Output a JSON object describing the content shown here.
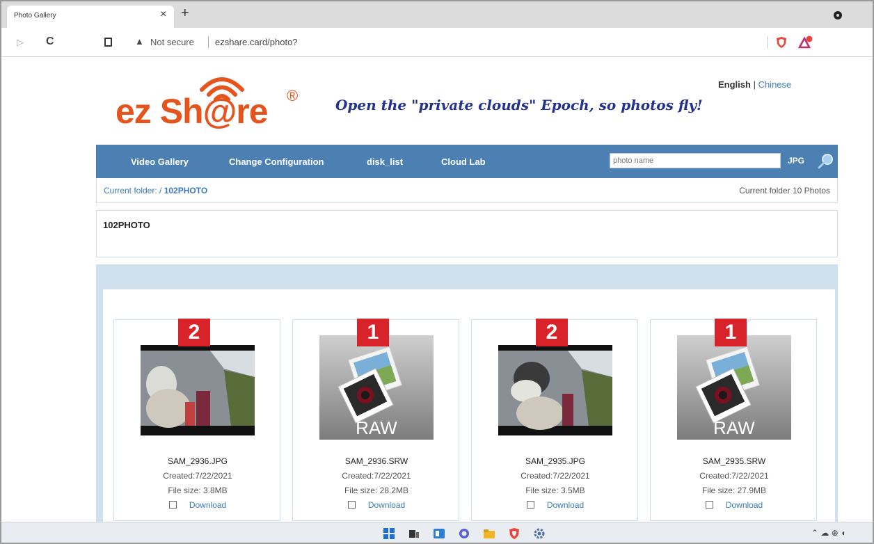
{
  "browser": {
    "tab_title": "Photo Gallery",
    "tab_close": "×",
    "new_tab": "+",
    "back": "▷",
    "reload": "C",
    "security_label": "Not secure",
    "url": "ezshare.card/photo?"
  },
  "header": {
    "logo_text": "ez Sh@re",
    "logo_mark": "®",
    "tagline": "Open the \"private clouds\" Epoch, so photos fly!",
    "lang_english": "English",
    "lang_sep": " | ",
    "lang_chinese": "Chinese"
  },
  "nav": {
    "items": [
      "Video Gallery",
      "Change Configuration",
      "disk_list",
      "Cloud Lab"
    ],
    "search_placeholder": "photo name",
    "search_type": "JPG"
  },
  "breadcrumb": {
    "prefix": "Current folder:  /  ",
    "folder": "102PHOTO",
    "count": "Current folder 10 Photos"
  },
  "folder_title": "102PHOTO",
  "photos": [
    {
      "badge": "2",
      "name": "SAM_2936.JPG",
      "created": "Created:7/22/2021",
      "size": "File size:   3.8MB",
      "download": "Download",
      "kind": "photo"
    },
    {
      "badge": "1",
      "name": "SAM_2936.SRW",
      "created": "Created:7/22/2021",
      "size": "File size:   28.2MB",
      "download": "Download",
      "kind": "raw",
      "raw_label": "RAW"
    },
    {
      "badge": "2",
      "name": "SAM_2935.JPG",
      "created": "Created:7/22/2021",
      "size": "File size:   3.5MB",
      "download": "Download",
      "kind": "photo"
    },
    {
      "badge": "1",
      "name": "SAM_2935.SRW",
      "created": "Created:7/22/2021",
      "size": "File size:   27.9MB",
      "download": "Download",
      "kind": "raw",
      "raw_label": "RAW"
    }
  ],
  "colors": {
    "brand_orange": "#e5541c",
    "nav_blue": "#4c7fb2",
    "badge_red": "#d8232a",
    "tagline_navy": "#23328a"
  }
}
